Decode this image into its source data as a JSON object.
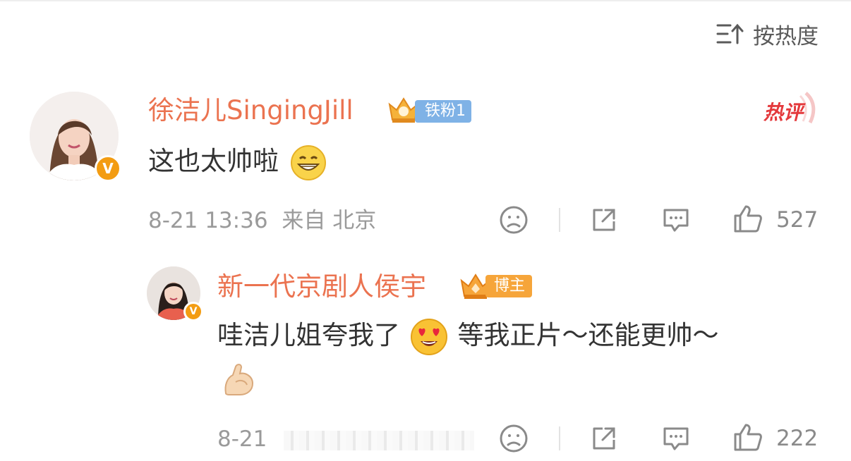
{
  "sort": {
    "label": "按热度",
    "icon": "sort-icon"
  },
  "comment": {
    "username": "徐洁儿SingingJill",
    "fan_badge": "铁粉1",
    "hot_tag": "热评",
    "text": "这也太帅啦",
    "time": "8-21 13:36",
    "location": "来自 北京",
    "likes": "527"
  },
  "reply": {
    "username": "新一代京剧人侯宇",
    "role_badge": "博主",
    "text_part1": "哇洁儿姐夸我了",
    "text_part2": "等我正片～还能更帅～",
    "time": "8-21",
    "likes": "222"
  },
  "colors": {
    "username": "#eb7350",
    "verified": "#f39c12",
    "hot": "#e4393c",
    "fan_badge": "#7fb2e6",
    "blogger_badge": "#f6a53a"
  }
}
